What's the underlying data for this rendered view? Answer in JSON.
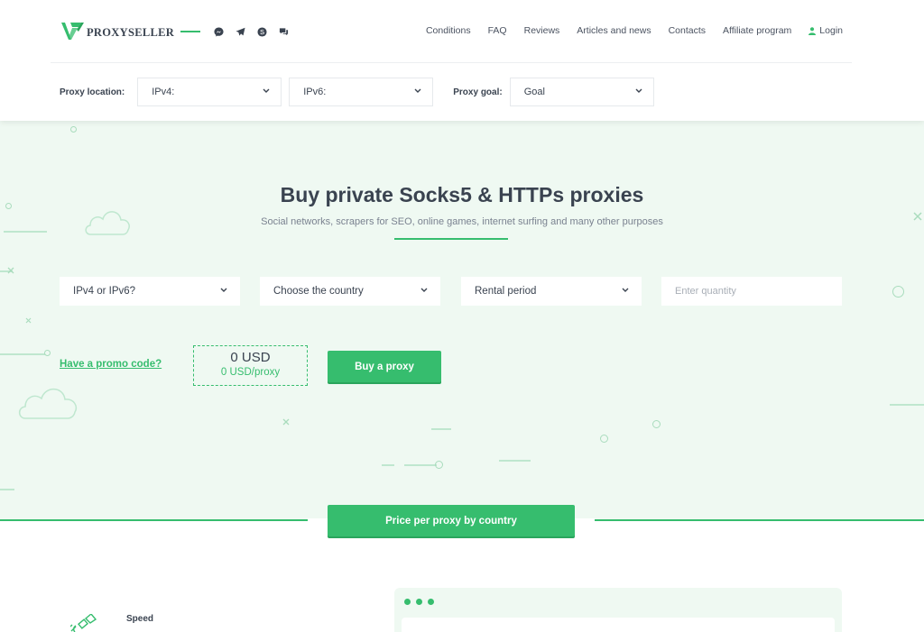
{
  "brand": {
    "name": "PROXYSELLER",
    "accent": "#36bd6e",
    "text": "#3a4350"
  },
  "social_icons": [
    "messenger-icon",
    "telegram-icon",
    "skype-icon",
    "chat-icon"
  ],
  "nav": {
    "items": [
      "Conditions",
      "FAQ",
      "Reviews",
      "Articles and news",
      "Contacts",
      "Affiliate program"
    ],
    "login": "Login"
  },
  "filters": {
    "location_label": "Proxy location:",
    "ipv4": "IPv4:",
    "ipv6": "IPv6:",
    "goal_label": "Proxy goal:",
    "goal": "Goal"
  },
  "hero": {
    "title": "Buy private Socks5 & HTTPs proxies",
    "subtitle": "Social networks, scrapers for SEO, online games, internet surfing and many other purposes",
    "selects": [
      "IPv4 or IPv6?",
      "Choose the country",
      "Rental period"
    ],
    "quantity_placeholder": "Enter quantity",
    "promo": "Have a promo code?",
    "price_total": "0 USD",
    "price_per": "0 USD/proxy",
    "buy": "Buy a proxy",
    "price_by_country": "Price per proxy by country"
  },
  "features": {
    "speed": "Speed"
  }
}
